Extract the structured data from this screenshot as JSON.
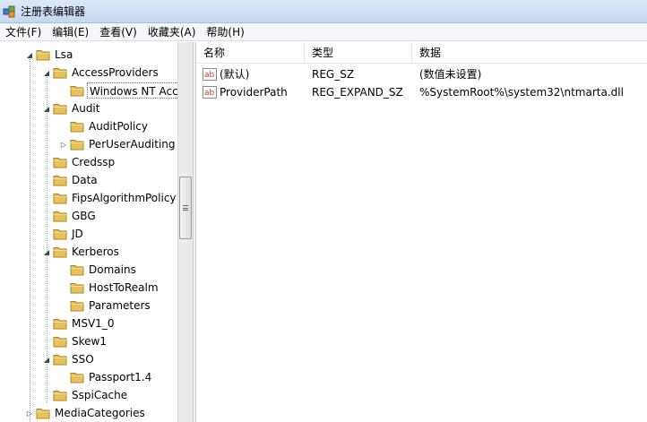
{
  "window": {
    "title": "注册表编辑器"
  },
  "menu": [
    "文件(F)",
    "编辑(E)",
    "查看(V)",
    "收藏夹(A)",
    "帮助(H)"
  ],
  "tree": [
    {
      "label": "Lsa",
      "depth": 1,
      "exp": "open"
    },
    {
      "label": "AccessProviders",
      "depth": 2,
      "exp": "open"
    },
    {
      "label": "Windows NT Acc",
      "depth": 3,
      "exp": "none",
      "selected": true
    },
    {
      "label": "Audit",
      "depth": 2,
      "exp": "open"
    },
    {
      "label": "AuditPolicy",
      "depth": 3,
      "exp": "none"
    },
    {
      "label": "PerUserAuditing",
      "depth": 3,
      "exp": "closed"
    },
    {
      "label": "Credssp",
      "depth": 2,
      "exp": "none"
    },
    {
      "label": "Data",
      "depth": 2,
      "exp": "none"
    },
    {
      "label": "FipsAlgorithmPolicy",
      "depth": 2,
      "exp": "none"
    },
    {
      "label": "GBG",
      "depth": 2,
      "exp": "none"
    },
    {
      "label": "JD",
      "depth": 2,
      "exp": "none"
    },
    {
      "label": "Kerberos",
      "depth": 2,
      "exp": "open"
    },
    {
      "label": "Domains",
      "depth": 3,
      "exp": "none"
    },
    {
      "label": "HostToRealm",
      "depth": 3,
      "exp": "none"
    },
    {
      "label": "Parameters",
      "depth": 3,
      "exp": "none"
    },
    {
      "label": "MSV1_0",
      "depth": 2,
      "exp": "none"
    },
    {
      "label": "Skew1",
      "depth": 2,
      "exp": "none"
    },
    {
      "label": "SSO",
      "depth": 2,
      "exp": "open"
    },
    {
      "label": "Passport1.4",
      "depth": 3,
      "exp": "none"
    },
    {
      "label": "SspiCache",
      "depth": 2,
      "exp": "none"
    },
    {
      "label": "MediaCategories",
      "depth": 1,
      "exp": "closed"
    }
  ],
  "columns": {
    "name": "名称",
    "type": "类型",
    "data": "数据"
  },
  "values": [
    {
      "name": "(默认)",
      "type": "REG_SZ",
      "data": "(数值未设置)"
    },
    {
      "name": "ProviderPath",
      "type": "REG_EXPAND_SZ",
      "data": "%SystemRoot%\\system32\\ntmarta.dll"
    }
  ],
  "icons": {
    "app": "registry-icon",
    "folder": "folder-icon",
    "value": "string-value-icon"
  },
  "colors": {
    "folder": "#e8c25a",
    "value_icon_text": "#c0392b"
  }
}
